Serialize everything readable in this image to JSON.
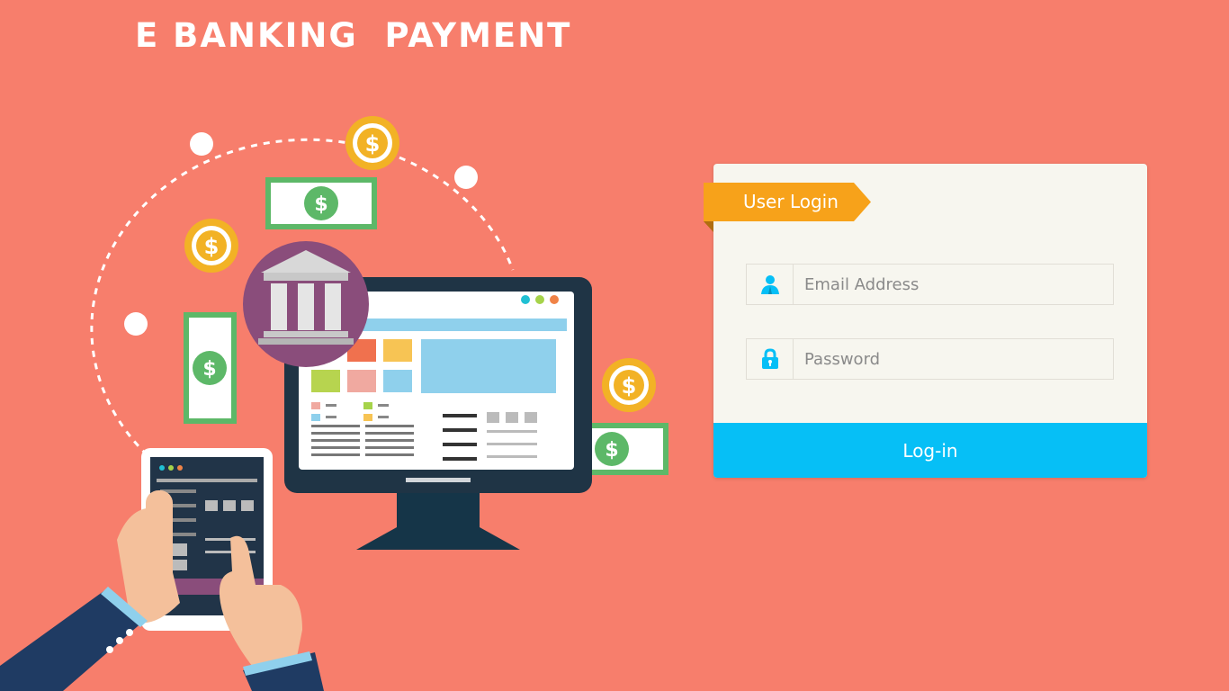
{
  "page": {
    "title": "E BANKING  PAYMENT"
  },
  "colors": {
    "background": "#f77e6c",
    "card": "#f7f6ef",
    "ribbon": "#f7a21a",
    "login_button": "#06bff6",
    "field_icon": "#06bff6"
  },
  "login": {
    "ribbon_label": "User Login",
    "email_placeholder": "Email Address",
    "email_icon": "user-icon",
    "password_placeholder": "Password",
    "password_icon": "lock-icon",
    "submit_label": "Log-in"
  },
  "illustration": {
    "dollar_sign": "$",
    "bank_icon": "bank-building-icon",
    "monitor_icon": "desktop-monitor",
    "tablet_icon": "tablet-with-hands"
  }
}
